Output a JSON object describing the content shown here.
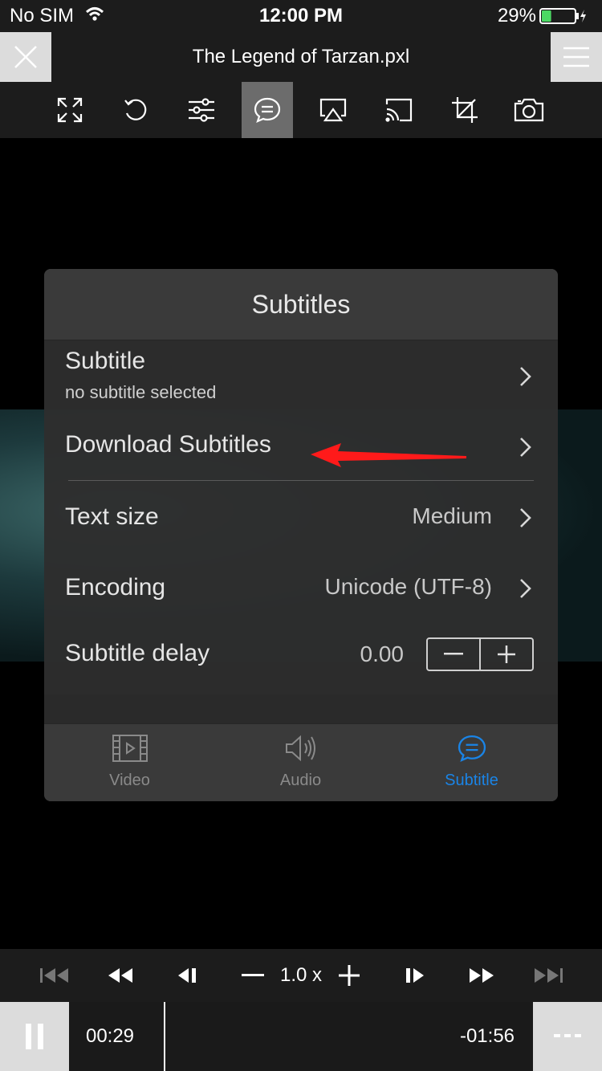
{
  "status_bar": {
    "carrier": "No SIM",
    "time": "12:00 PM",
    "battery_percent": "29%",
    "battery_level": 0.29,
    "charging": true
  },
  "title_bar": {
    "title": "The Legend of Tarzan.pxl",
    "close_icon": "close-icon",
    "menu_icon": "hamburger-menu-icon"
  },
  "toolbar": {
    "items": [
      {
        "icon": "fullscreen-icon",
        "active": false
      },
      {
        "icon": "rotate-icon",
        "active": false
      },
      {
        "icon": "sliders-icon",
        "active": false
      },
      {
        "icon": "subtitle-chat-icon",
        "active": true
      },
      {
        "icon": "airplay-icon",
        "active": false
      },
      {
        "icon": "cast-icon",
        "active": false
      },
      {
        "icon": "crop-icon",
        "active": false
      },
      {
        "icon": "camera-icon",
        "active": false
      }
    ]
  },
  "panel": {
    "title": "Subtitles",
    "rows": {
      "subtitle": {
        "label": "Subtitle",
        "sublabel": "no subtitle selected"
      },
      "download": {
        "label": "Download Subtitles"
      },
      "text_size": {
        "label": "Text size",
        "value": "Medium"
      },
      "encoding": {
        "label": "Encoding",
        "value": "Unicode (UTF-8)"
      },
      "delay": {
        "label": "Subtitle delay",
        "value": "0.00",
        "minus": "−",
        "plus": "+"
      }
    },
    "tabs": [
      {
        "label": "Video",
        "icon": "film-icon",
        "selected": false
      },
      {
        "label": "Audio",
        "icon": "speaker-icon",
        "selected": false
      },
      {
        "label": "Subtitle",
        "icon": "subtitle-chat-icon",
        "selected": true
      }
    ],
    "accent_color": "#1a84e6"
  },
  "controls": {
    "speed": "1.0 x",
    "elapsed": "00:29",
    "remaining": "-01:56"
  }
}
